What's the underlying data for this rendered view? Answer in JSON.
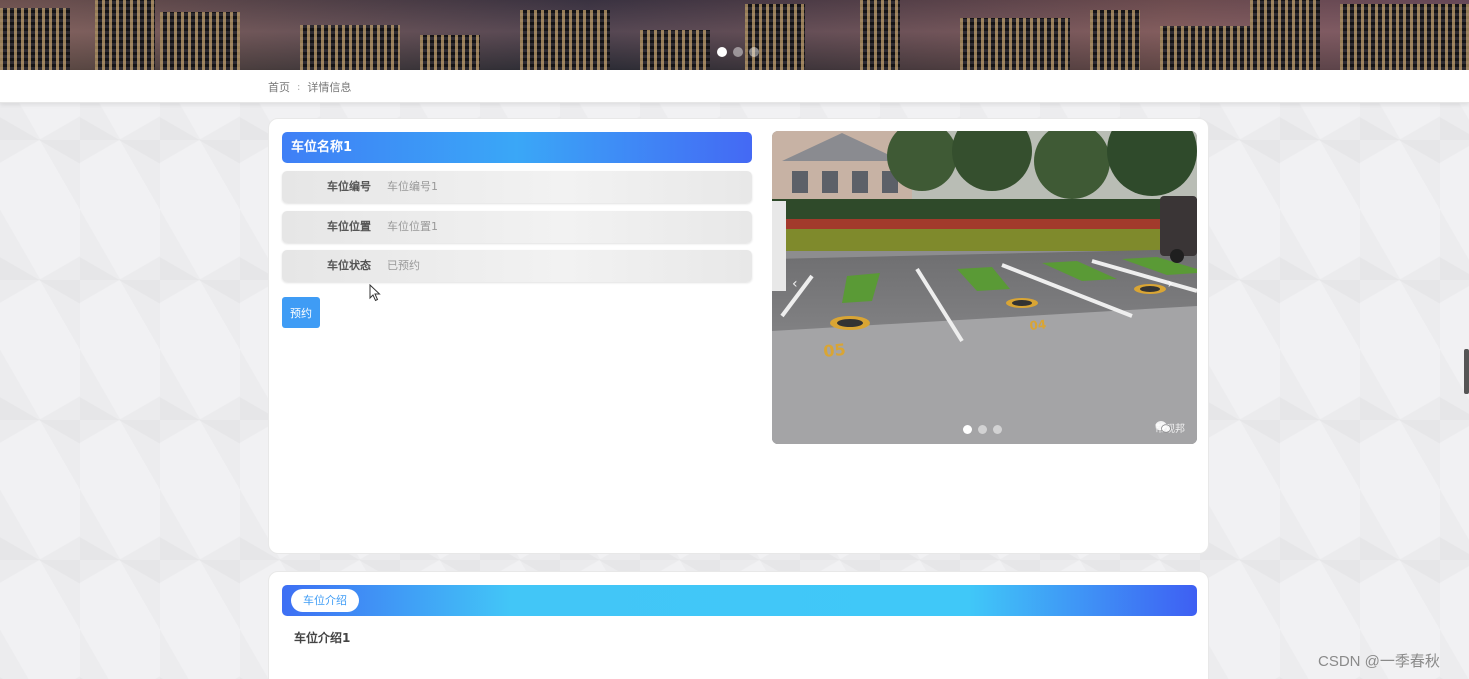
{
  "banner": {
    "slides": 3,
    "active_slide": 1
  },
  "breadcrumb": {
    "home": "首页",
    "separator": ":",
    "current": "详情信息"
  },
  "detail": {
    "title": "车位名称1",
    "fields": [
      {
        "label": "车位编号",
        "value": "车位编号1"
      },
      {
        "label": "车位位置",
        "value": "车位位置1"
      },
      {
        "label": "车位状态",
        "value": "已预约"
      }
    ],
    "book_label": "预约"
  },
  "carousel": {
    "slides": 3,
    "active_slide": 1,
    "prev_arrow": "‹",
    "next_arrow": "›",
    "watermark": "帮观邦",
    "spot_numbers": [
      "05",
      "04"
    ]
  },
  "intro": {
    "tab_label": "车位介绍",
    "text": "车位介绍1"
  },
  "footer": {
    "watermark": "CSDN @一季春秋"
  },
  "colors": {
    "accent": "#3f9cf5",
    "title_gradient_start": "#3f7ff6",
    "intro_gradient_mid": "#42c6f7"
  }
}
